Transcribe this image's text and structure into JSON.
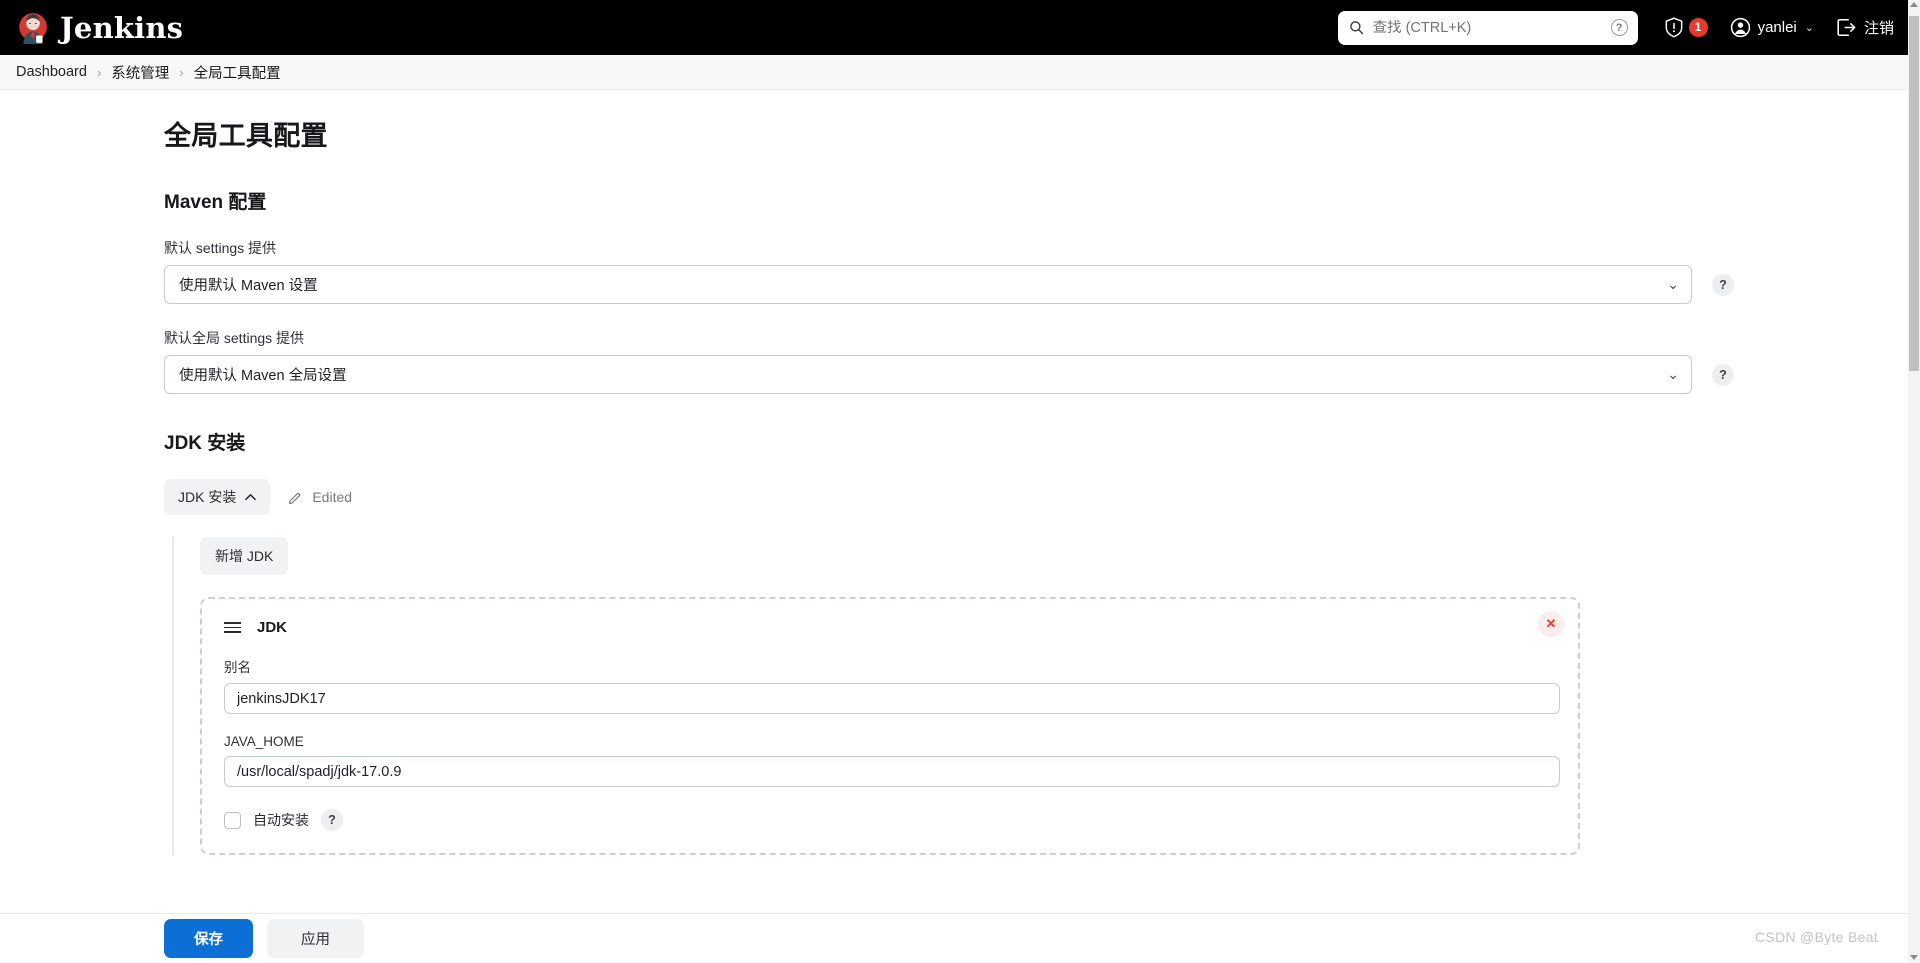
{
  "header": {
    "brand": "Jenkins",
    "brand_logo_icon": "jenkins-butler-logo",
    "search": {
      "placeholder": "查找 (CTRL+K)",
      "value": "",
      "icon": "search-icon",
      "help_icon": "question-circle-icon",
      "help_label": "?"
    },
    "security_alert": {
      "icon": "shield-exclamation-icon",
      "count": "1"
    },
    "user": {
      "icon": "user-circle-icon",
      "name": "yanlei",
      "chevron": "⌄"
    },
    "logout": {
      "icon": "logout-icon",
      "label": "注销"
    }
  },
  "breadcrumb": {
    "items": [
      {
        "label": "Dashboard"
      },
      {
        "label": "系统管理"
      },
      {
        "label": "全局工具配置"
      }
    ],
    "separator": "›"
  },
  "main": {
    "page_title": "全局工具配置",
    "maven": {
      "section_title": "Maven 配置",
      "fields": [
        {
          "label": "默认 settings 提供",
          "value": "使用默认 Maven 设置",
          "chevron": "⌄",
          "help": "?"
        },
        {
          "label": "默认全局 settings 提供",
          "value": "使用默认 Maven 全局设置",
          "chevron": "⌄",
          "help": "?"
        }
      ]
    },
    "jdk": {
      "section_title": "JDK 安装",
      "toggle_label": "JDK 安装",
      "toggle_chevron": "⌃",
      "edited_label": "Edited",
      "edited_icon": "pencil-icon",
      "add_label": "新增 JDK",
      "card": {
        "title": "JDK",
        "drag_icon": "drag-handle-icon",
        "delete_icon": "close-icon",
        "delete_label": "✕",
        "alias": {
          "label": "别名",
          "value": "jenkinsJDK17"
        },
        "java_home": {
          "label": "JAVA_HOME",
          "value": "/usr/local/spadj/jdk-17.0.9"
        },
        "auto_install": {
          "label": "自动安装",
          "checked": false,
          "help": "?"
        }
      }
    }
  },
  "footer": {
    "save_label": "保存",
    "apply_label": "应用"
  },
  "watermark": "CSDN @Byte Beat",
  "colors": {
    "header_bg": "#000000",
    "primary": "#0b6fd6",
    "danger": "#e8392e",
    "border": "#c3cdd4"
  }
}
